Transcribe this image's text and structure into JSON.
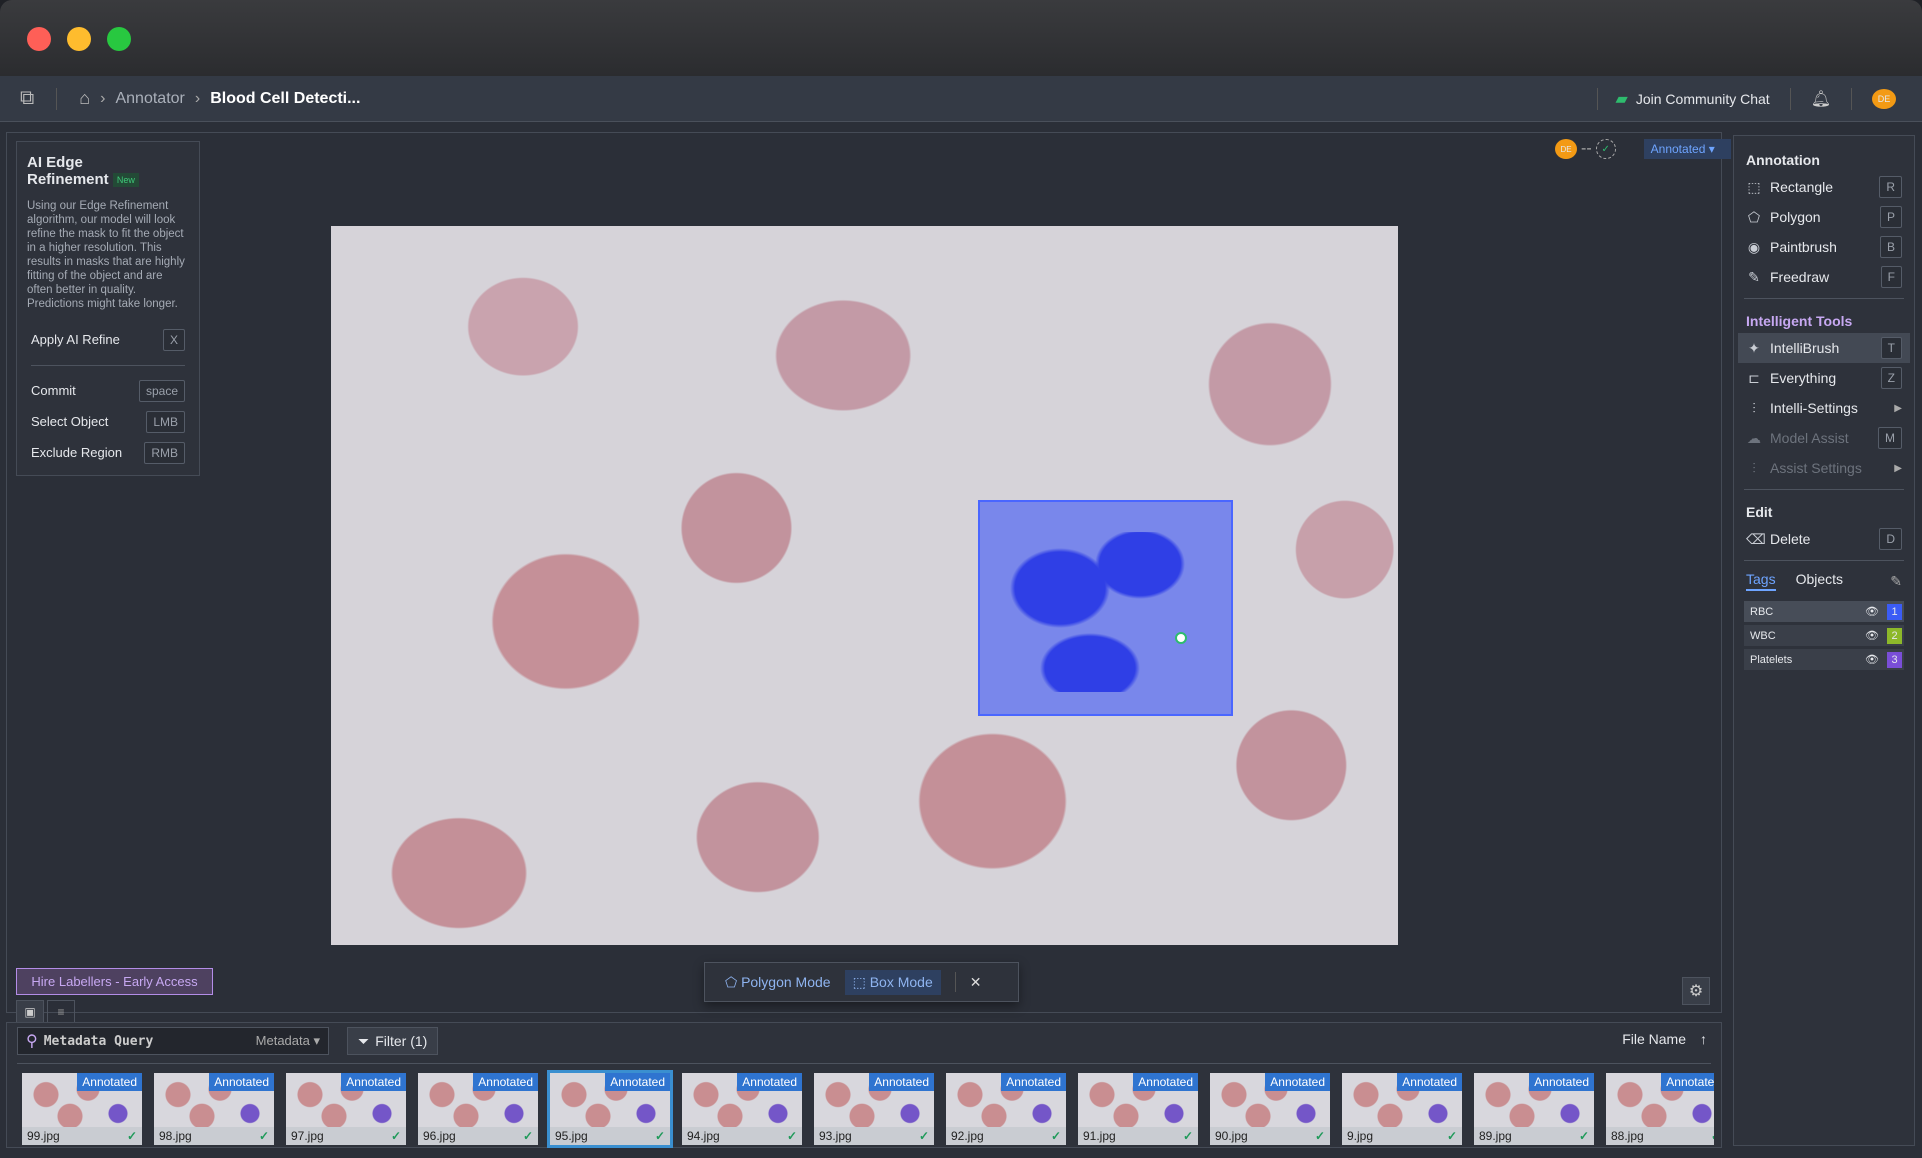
{
  "nav": {
    "breadcrumb": [
      "Annotator",
      "Blood Cell Detecti..."
    ],
    "community": "Join Community Chat",
    "avatar": "DE"
  },
  "left_panel": {
    "title_line1": "AI Edge",
    "title_line2": "Refinement",
    "badge": "New",
    "description": "Using our Edge Refinement algorithm, our model will look refine the mask to fit the object in a higher resolution. This results in masks that are highly fitting of the object and are often better in quality. Predictions might take longer.",
    "apply": {
      "label": "Apply AI Refine",
      "key": "X"
    },
    "shortcuts": [
      {
        "label": "Commit",
        "key": "space"
      },
      {
        "label": "Select Object",
        "key": "LMB"
      },
      {
        "label": "Exclude Region",
        "key": "RMB"
      }
    ]
  },
  "canvas": {
    "avatar": "DE",
    "status": "Annotated",
    "hire": "Hire Labellers - Early Access",
    "modes": {
      "polygon": "Polygon Mode",
      "box": "Box Mode"
    }
  },
  "right_panel": {
    "annotation_title": "Annotation",
    "annotation_tools": [
      {
        "label": "Rectangle",
        "key": "R"
      },
      {
        "label": "Polygon",
        "key": "P"
      },
      {
        "label": "Paintbrush",
        "key": "B"
      },
      {
        "label": "Freedraw",
        "key": "F"
      }
    ],
    "intelligent_title": "Intelligent Tools",
    "intelligent_tools": [
      {
        "label": "IntelliBrush",
        "key": "T"
      },
      {
        "label": "Everything",
        "key": "Z"
      },
      {
        "label": "Intelli-Settings",
        "key": ""
      },
      {
        "label": "Model Assist",
        "key": "M"
      },
      {
        "label": "Assist Settings",
        "key": ""
      }
    ],
    "edit_title": "Edit",
    "edit_tools": [
      {
        "label": "Delete",
        "key": "D"
      }
    ],
    "tabs": [
      "Tags",
      "Objects"
    ],
    "tags": [
      {
        "name": "RBC",
        "num": "1",
        "color": "#3b5cf5"
      },
      {
        "name": "WBC",
        "num": "2",
        "color": "#8db82a"
      },
      {
        "name": "Platelets",
        "num": "3",
        "color": "#7a4ed8"
      }
    ]
  },
  "filmstrip": {
    "search_placeholder": "Metadata Query",
    "metadata": "Metadata",
    "filter": "Filter (1)",
    "sort": "File Name",
    "badge": "Annotated",
    "files": [
      "99.jpg",
      "98.jpg",
      "97.jpg",
      "96.jpg",
      "95.jpg",
      "94.jpg",
      "93.jpg",
      "92.jpg",
      "91.jpg",
      "90.jpg",
      "9.jpg",
      "89.jpg",
      "88.jpg"
    ],
    "selected": "95.jpg"
  }
}
